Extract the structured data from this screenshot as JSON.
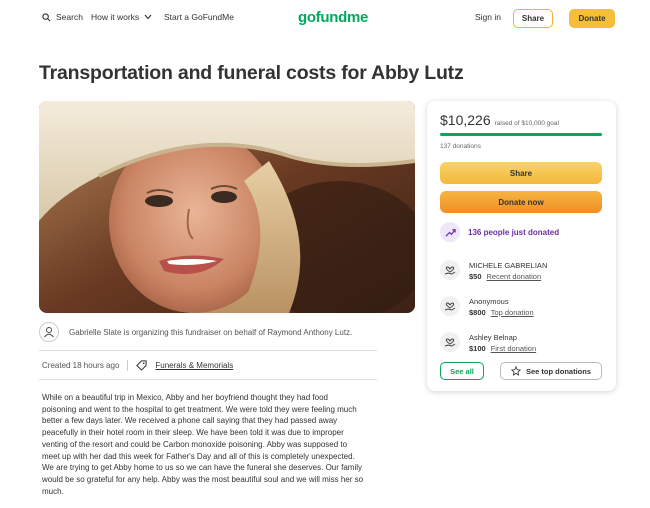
{
  "header": {
    "search_label": "Search",
    "how_label": "How it works",
    "start_label": "Start a GoFundMe",
    "logo_text": "gofundme",
    "signin_label": "Sign in",
    "share_label": "Share",
    "donate_label": "Donate"
  },
  "campaign": {
    "title": "Transportation and funeral costs for Abby Lutz",
    "organizer_text": "Gabrielle Slate is organizing this fundraiser on behalf of Raymond Anthony Lutz.",
    "created": "Created 18 hours ago",
    "category": "Funerals & Memorials",
    "story_lines": [
      "While on a beautiful trip in Mexico, Abby and her boyfriend thought they had food",
      "poisoning and went to the hospital to get treatment. We were told they were feeling much",
      "better a few days later. We received a phone call saying that they had passed away",
      "peacefully in their hotel room in their sleep. We have been told it was due to improper",
      "venting of the resort and could be Carbon monoxide poisoning. Abby was supposed to",
      "meet up with her dad this week for Father's Day and all of this is completely unexpected.",
      "We are trying to get Abby home to us so we can have the funeral she deserves. Our family",
      "would be so grateful for any help. Abby was the most beautiful soul and we will miss her so",
      "much."
    ]
  },
  "sidebar": {
    "raised": "$10,226",
    "goal_text": "raised of $10,000 goal",
    "progress_fraction": 1.0,
    "donations_count": "137 donations",
    "share_label": "Share",
    "donate_label": "Donate now",
    "recent_text": "136 people just donated",
    "donors": [
      {
        "name": "MICHELE GABRELIAN",
        "amount": "$50",
        "tag": "Recent donation"
      },
      {
        "name": "Anonymous",
        "amount": "$800",
        "tag": "Top donation"
      },
      {
        "name": "Ashley Belnap",
        "amount": "$100",
        "tag": "First donation"
      }
    ],
    "see_all_label": "See all",
    "see_top_label": "See top donations"
  },
  "colors": {
    "brand_green": "#02a95c",
    "accent_yellow": "#f6bf3a",
    "donate_orange": "#f08f24",
    "recent_purple": "#6b2fa3"
  },
  "icons": [
    "search-icon",
    "chevron-down-icon",
    "avatar-icon",
    "tag-icon",
    "trend-up-icon",
    "hand-heart-icon",
    "star-icon"
  ]
}
